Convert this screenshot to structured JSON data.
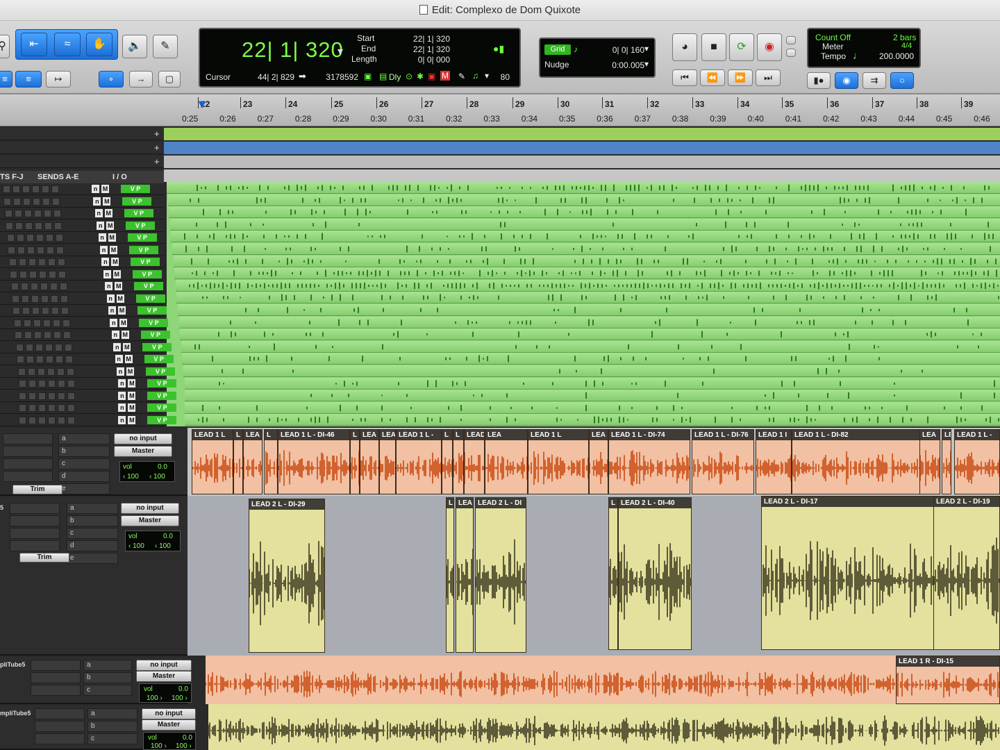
{
  "window": {
    "title": "Edit: Complexo de Dom Quixote"
  },
  "toolbar": {
    "main_counter": "22| 1| 320",
    "start_label": "Start",
    "end_label": "End",
    "length_label": "Length",
    "start_value": "22| 1| 320",
    "end_value": "22| 1| 320",
    "length_value": "0| 0| 000",
    "cursor_label": "Cursor",
    "cursor_value": "44| 2| 829",
    "samples_value": "3178592",
    "dly_label": "Dly",
    "tempo_small": "80",
    "grid_label": "Grid",
    "grid_value": "0| 0| 160",
    "nudge_label": "Nudge",
    "nudge_value": "0:00.005",
    "count_off": "Count Off",
    "count_bars": "2 bars",
    "meter_label": "Meter",
    "meter_value": "4/4",
    "tempo_label": "Tempo",
    "tempo_value": "200.0000"
  },
  "ruler": {
    "bars": [
      "22",
      "23",
      "24",
      "25",
      "26",
      "27",
      "28",
      "29",
      "30",
      "31",
      "32",
      "33",
      "34",
      "35",
      "36",
      "37",
      "38",
      "39"
    ],
    "seconds": [
      "0:25",
      "0:26",
      "0:27",
      "0:28",
      "0:29",
      "0:30",
      "0:31",
      "0:32",
      "0:33",
      "0:34",
      "0:35",
      "0:36",
      "0:37",
      "0:38",
      "0:39",
      "0:40",
      "0:41",
      "0:42",
      "0:43",
      "0:44",
      "0:45",
      "0:46"
    ]
  },
  "columns": {
    "inserts": "TS F-J",
    "sends": "SENDS A-E",
    "io": "I / O"
  },
  "mini_tracks": {
    "n_label": "n",
    "m_label": "M",
    "numbered": {
      "9": "7",
      "12": "3",
      "32": "7",
      "34": "5"
    },
    "io_labels": [
      "V",
      "P",
      "D"
    ],
    "count": 20
  },
  "tracks": [
    {
      "io_input": "no input",
      "io_output": "Master",
      "vol_label": "vol",
      "vol_value": "0.0",
      "pan_left": "‹ 100",
      "pan_right": "‹ 100",
      "trim_label": "Trim",
      "sends": [
        "a",
        "b",
        "c",
        "d",
        "e"
      ],
      "clips": [
        "LEAD 1 L",
        "L",
        "LEA",
        "L",
        "LEAD 1 L - DI-46",
        "L",
        "LEA",
        "LEA",
        "LEAD 1 L -",
        "L",
        "L",
        "LEAD 1 L -",
        "LEA",
        "LEAD 1 L",
        "LEA",
        "LEAD 1 L - DI-74",
        "LEAD 1 L - DI-76",
        "LEAD 1 I",
        "LEAD 1 L - DI-82",
        "LEA",
        "LE",
        "LEAD 1 L -"
      ]
    },
    {
      "io_input": "no input",
      "io_output": "Master",
      "vol_label": "vol",
      "vol_value": "0.0",
      "pan_left": "‹ 100",
      "pan_right": "‹ 100",
      "trim_label": "Trim",
      "sends": [
        "a",
        "b",
        "c",
        "d",
        "e"
      ],
      "clips": [
        "LEAD 2 L - DI-29",
        "L",
        "LEA",
        "LEAD 2 L - DI",
        "L",
        "LEAD 2 L - DI-40",
        "LEAD 2 L - DI-17",
        "LEAD 2 L - DI-19"
      ]
    },
    {
      "name": "pliTube5",
      "io_input": "no input",
      "io_output": "Master",
      "vol_label": "vol",
      "vol_value": "0.0",
      "pan_left": "100 ›",
      "pan_right": "100 ›",
      "sends": [
        "a",
        "b",
        "c",
        "d",
        "e"
      ],
      "clips": [
        "LEAD 1 R - DI-15"
      ]
    },
    {
      "name": "mpliTube5",
      "io_input": "no input",
      "io_output": "Master",
      "vol_label": "vol",
      "vol_value": "0.0",
      "pan_left": "100 ›",
      "pan_right": "100 ›",
      "sends": [
        "a",
        "b",
        "c",
        "d"
      ],
      "clips": []
    }
  ],
  "colors": {
    "accent_green": "#7dff4a",
    "clip_orange": "#f2c0a3",
    "wave_orange": "#c94a12",
    "clip_yellow": "#e3e19d",
    "wave_dark": "#3c3a20",
    "mini_green": "#8fd679",
    "lane_green": "#9ccf5e",
    "lane_blue": "#4f84c8"
  },
  "icons": {
    "tools": [
      "zoom-icon",
      "trim-tool-icon",
      "selector-tool-icon",
      "grabber-hand-icon",
      "speaker-scrub-icon",
      "pencil-icon"
    ],
    "transport": [
      "online-icon",
      "stop-icon",
      "loop-play-icon",
      "record-icon",
      "return-to-zero-icon",
      "rewind-icon",
      "fast-forward-icon",
      "go-to-end-icon"
    ]
  }
}
